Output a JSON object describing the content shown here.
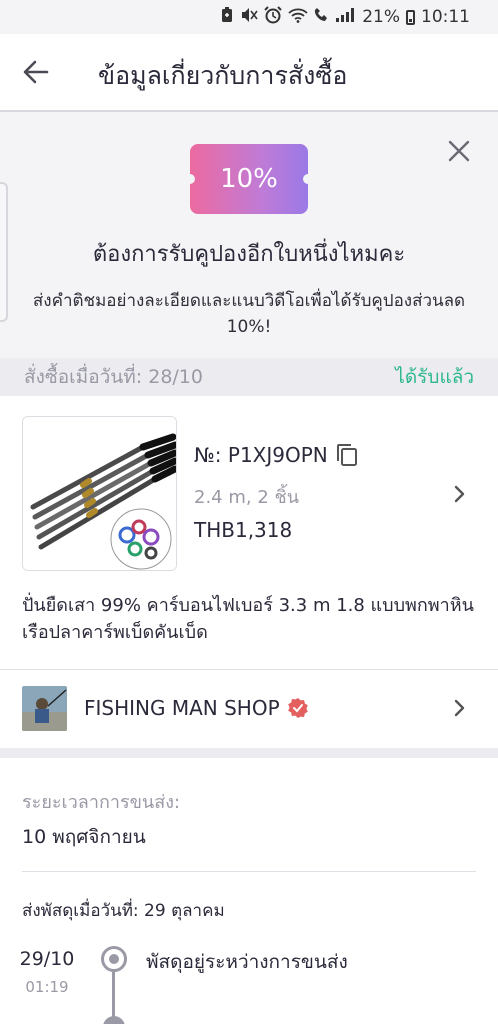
{
  "status_bar": {
    "battery": "21%",
    "time": "10:11",
    "icons": [
      "battery-saver-icon",
      "mute-icon",
      "alarm-icon",
      "wifi-icon",
      "call-icon",
      "signal-icon",
      "battery-icon"
    ]
  },
  "header": {
    "back_icon": "back-arrow-icon",
    "title": "ข้อมูลเกี่ยวกับการสั่งซื้อ"
  },
  "promo": {
    "coupon_label": "10%",
    "headline": "ต้องการรับคูปองอีกใบหนึ่งไหมคะ",
    "body": "ส่งคำติชมอย่างละเอียดและแนบวิดีโอเพื่อได้รับคูปองส่วนลด 10%!",
    "colors": {
      "coupon_start": "#ec6aa0",
      "coupon_end": "#9a79e6"
    }
  },
  "order": {
    "date_label": "สั่งซื้อเมื่อวันที่: 28/10",
    "status": "ได้รับแล้ว",
    "status_color": "#2db88e",
    "number": "№: P1XJ9OPN",
    "variant": "2.4 m, 2 ชิ้น",
    "price": "THB1,318",
    "product_title": "ปั่นยืดเสา 99% คาร์บอนไฟเบอร์ 3.3 m 1.8 แบบพกพาหินเรือปลาคาร์พเบ็ดคันเบ็ด"
  },
  "shop": {
    "name": "FISHING MAN SHOP",
    "verified_color": "#e4605e"
  },
  "delivery": {
    "eta_label": "ระยะเวลาการขนส่ง:",
    "eta_value": "10 พฤศจิกายน",
    "ship_prefix": "ส่งพัสดุเมื่อวันที่: ",
    "ship_date": "29 ตุลาคม",
    "timeline": [
      {
        "date": "29/10",
        "time": "01:19",
        "text": "พัสดุอยู่ระหว่างการขนส่ง"
      }
    ]
  }
}
